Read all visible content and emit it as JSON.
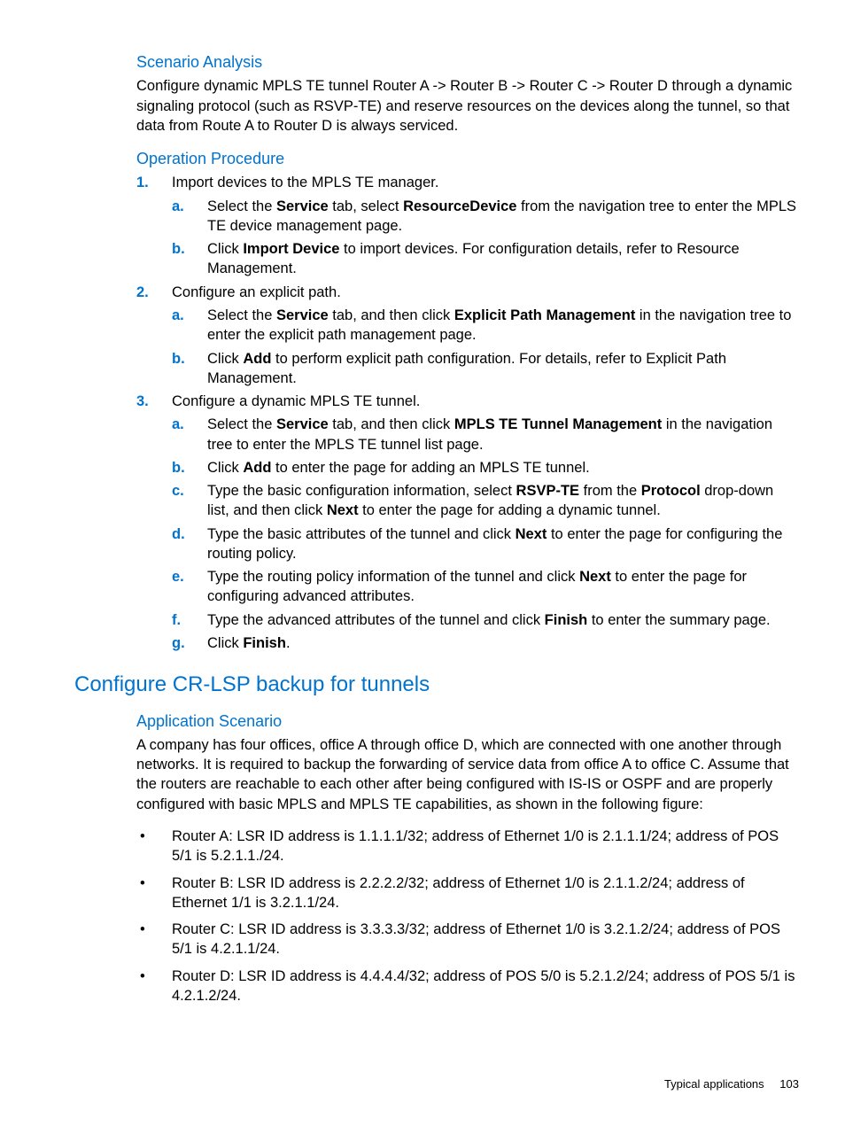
{
  "sec1": {
    "h": "Scenario Analysis",
    "p": "Configure dynamic MPLS TE tunnel Router A -> Router B -> Router C -> Router D through a dynamic signaling protocol (such as RSVP-TE) and reserve resources on the devices along the tunnel, so that data from Route A to Router D is always serviced."
  },
  "sec2": {
    "h": "Operation Procedure",
    "steps": [
      {
        "m": "1.",
        "t": "Import devices to the MPLS TE manager.",
        "sub": [
          {
            "m": "a.",
            "pre": "Select the ",
            "b1": "Service",
            "mid1": " tab, select ",
            "b2": "ResourceDevice",
            "post": " from the navigation tree to enter the MPLS TE device management page."
          },
          {
            "m": "b.",
            "pre": "Click ",
            "b1": "Import Device",
            "mid1": " to import devices. For configuration details, refer to Resource Management.",
            "b2": "",
            "post": ""
          }
        ]
      },
      {
        "m": "2.",
        "t": "Configure an explicit path.",
        "sub": [
          {
            "m": "a.",
            "pre": "Select the ",
            "b1": "Service",
            "mid1": " tab, and then click ",
            "b2": "Explicit Path Management",
            "post": " in the navigation tree to enter the explicit path management page."
          },
          {
            "m": "b.",
            "pre": "Click ",
            "b1": "Add",
            "mid1": " to perform explicit path configuration. For details, refer to Explicit Path Management.",
            "b2": "",
            "post": ""
          }
        ]
      },
      {
        "m": "3.",
        "t": "Configure a dynamic MPLS TE tunnel.",
        "sub": [
          {
            "m": "a.",
            "pre": "Select the ",
            "b1": "Service",
            "mid1": " tab, and then click ",
            "b2": "MPLS TE Tunnel Management",
            "post": " in the navigation tree to enter the MPLS TE tunnel list page."
          },
          {
            "m": "b.",
            "pre": "Click ",
            "b1": "Add",
            "mid1": " to enter the page for adding an MPLS TE tunnel.",
            "b2": "",
            "post": ""
          },
          {
            "m": "c.",
            "pre": "Type the basic configuration information, select ",
            "b1": "RSVP-TE",
            "mid1": " from the ",
            "b2": "Protocol",
            "mid2": " drop-down list, and then click ",
            "b3": "Next",
            "post": " to enter the page for adding a dynamic tunnel."
          },
          {
            "m": "d.",
            "pre": "Type the basic attributes of the tunnel and click ",
            "b1": "Next",
            "mid1": " to enter the page for configuring the routing policy.",
            "b2": "",
            "post": ""
          },
          {
            "m": "e.",
            "pre": "Type the routing policy information of the tunnel and click ",
            "b1": "Next",
            "mid1": " to enter the page for configuring advanced attributes.",
            "b2": "",
            "post": ""
          },
          {
            "m": "f.",
            "pre": "Type the advanced attributes of the tunnel and click ",
            "b1": "Finish",
            "mid1": " to enter the summary page.",
            "b2": "",
            "post": ""
          },
          {
            "m": "g.",
            "pre": "Click ",
            "b1": "Finish",
            "mid1": ".",
            "b2": "",
            "post": ""
          }
        ]
      }
    ]
  },
  "sec3": {
    "h2": "Configure CR-LSP backup for tunnels",
    "h3": "Application Scenario",
    "p": "A company has four offices, office A through office D, which are connected with one another through networks. It is required to backup the forwarding of service data from office A to office C. Assume that the routers are reachable to each other after being configured with IS-IS or OSPF and are properly configured with basic MPLS and MPLS TE capabilities, as shown in the following figure:",
    "bullets": [
      "Router A: LSR ID address is 1.1.1.1/32; address of Ethernet 1/0 is 2.1.1.1/24; address of POS 5/1 is 5.2.1.1./24.",
      "Router B: LSR ID address is 2.2.2.2/32; address of Ethernet 1/0 is 2.1.1.2/24; address of Ethernet 1/1 is 3.2.1.1/24.",
      "Router C: LSR ID address is 3.3.3.3/32; address of Ethernet 1/0 is 3.2.1.2/24; address of POS 5/1 is 4.2.1.1/24.",
      "Router D: LSR ID address is 4.4.4.4/32; address of POS 5/0 is 5.2.1.2/24; address of POS 5/1 is 4.2.1.2/24."
    ]
  },
  "footer": {
    "label": "Typical applications",
    "page": "103"
  }
}
